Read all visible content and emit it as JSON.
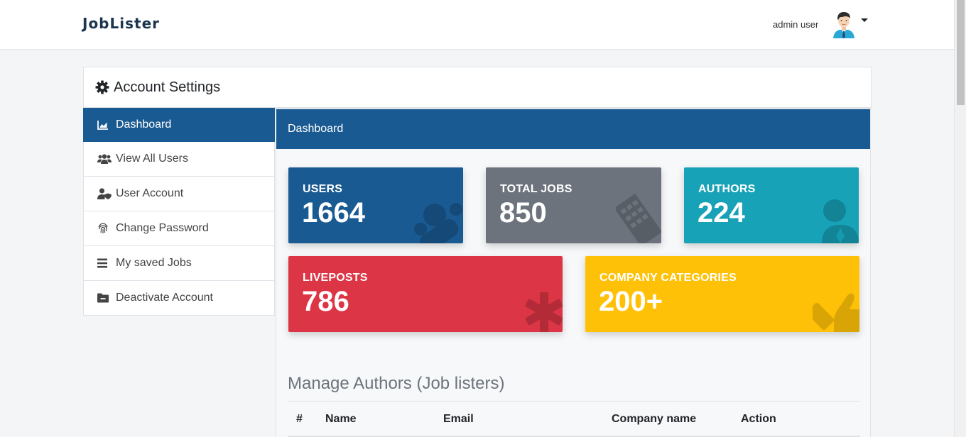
{
  "brand": "JobLister",
  "user": {
    "name": "admin user"
  },
  "settings": {
    "title": "Account Settings"
  },
  "sidebar": {
    "items": [
      {
        "label": "Dashboard",
        "icon": "chart-area-icon",
        "active": true
      },
      {
        "label": "View All Users",
        "icon": "users-icon"
      },
      {
        "label": "User Account",
        "icon": "user-shield-icon"
      },
      {
        "label": "Change Password",
        "icon": "fingerprint-icon"
      },
      {
        "label": "My saved Jobs",
        "icon": "list-icon"
      },
      {
        "label": "Deactivate Account",
        "icon": "folder-minus-icon"
      }
    ]
  },
  "main": {
    "header": "Dashboard",
    "stats": [
      {
        "label": "USERS",
        "value": "1664",
        "color": "#1a5a92",
        "icon": "users-icon"
      },
      {
        "label": "TOTAL JOBS",
        "value": "850",
        "color": "#6c737d",
        "icon": "building-icon"
      },
      {
        "label": "AUTHORS",
        "value": "224",
        "color": "#17a2b8",
        "icon": "user-tie-icon"
      },
      {
        "label": "LIVEPOSTS",
        "value": "786",
        "color": "#dc3545",
        "icon": "asterisk-icon"
      },
      {
        "label": "COMPANY CATEGORIES",
        "value": "200+",
        "color": "#ffc107",
        "icon": "check-icon"
      }
    ],
    "section_title": "Manage Authors (Job listers)",
    "table": {
      "columns": [
        "#",
        "Name",
        "Email",
        "Company name",
        "Action"
      ]
    }
  }
}
